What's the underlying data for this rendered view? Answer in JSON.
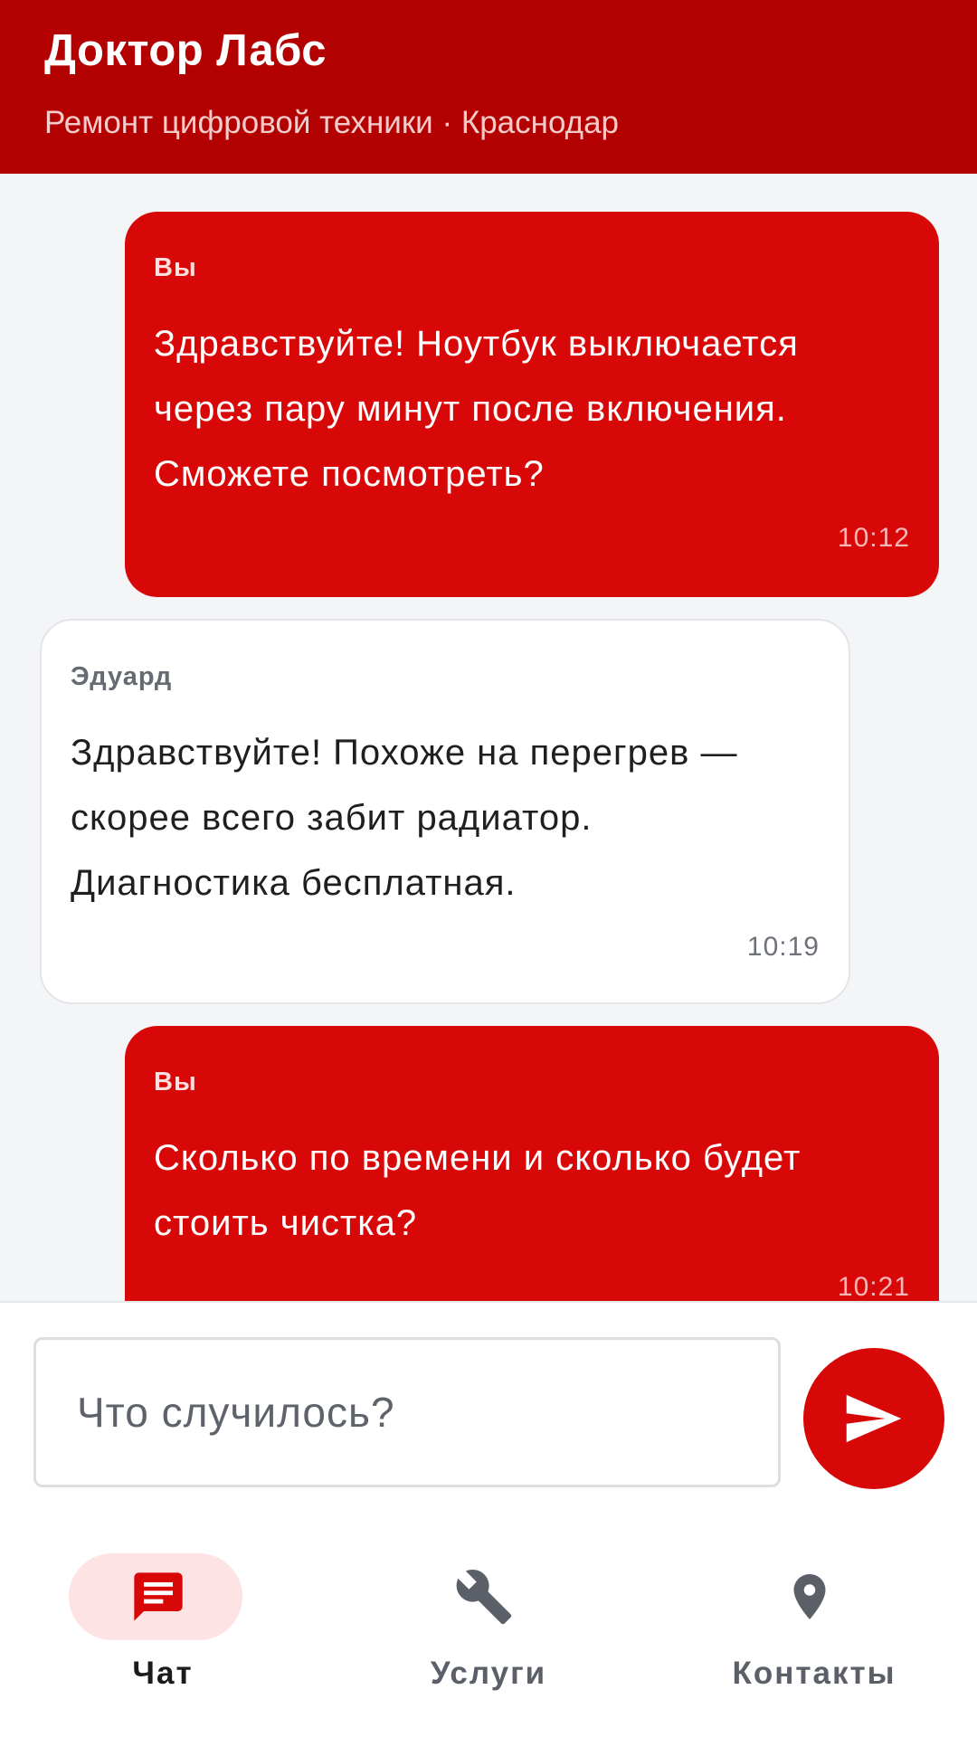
{
  "header": {
    "title": "Доктор Лабс",
    "subtitle": "Ремонт цифровой техники · Краснодар"
  },
  "messages": [
    {
      "direction": "outgoing",
      "sender": "Вы",
      "lines": [
        "Здравствуйте! Ноутбук выключается",
        "через пару минут после включения.",
        "Сможете посмотреть?"
      ],
      "time": "10:12"
    },
    {
      "direction": "incoming",
      "sender": "Эдуард",
      "lines": [
        "Здравствуйте! Похоже на перегрев —",
        "скорее всего забит радиатор.",
        "Диагностика бесплатная."
      ],
      "time": "10:19"
    },
    {
      "direction": "outgoing",
      "sender": "Вы",
      "lines": [
        "Сколько по времени и сколько будет",
        "стоить чистка?"
      ],
      "time": "10:21"
    }
  ],
  "composer": {
    "placeholder": "Что случилось?",
    "send_icon": "send-icon"
  },
  "nav": [
    {
      "label": "Чат",
      "icon": "chat-icon",
      "active": true
    },
    {
      "label": "Услуги",
      "icon": "wrench-icon",
      "active": false
    },
    {
      "label": "Контакты",
      "icon": "location-pin-icon",
      "active": false
    }
  ],
  "colors": {
    "header": "#b30000",
    "accent": "#d80808",
    "background": "#f4f5f7",
    "active_pill": "#fde3e3"
  }
}
